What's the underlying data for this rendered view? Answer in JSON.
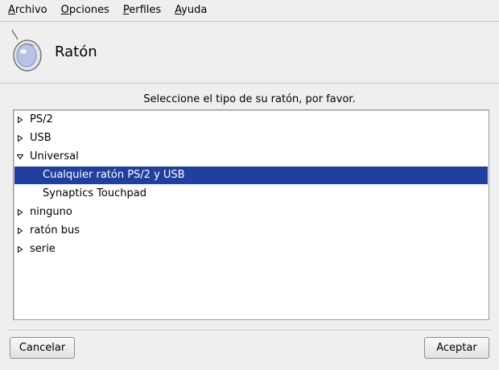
{
  "menubar": {
    "items": [
      {
        "accel": "A",
        "rest": "rchivo"
      },
      {
        "accel": "O",
        "rest": "pciones"
      },
      {
        "accel": "P",
        "rest": "erfiles"
      },
      {
        "accel": "A",
        "rest": "yuda"
      }
    ]
  },
  "header": {
    "title": "Ratón",
    "icon": "mouse-icon"
  },
  "prompt": "Seleccione el tipo de su ratón, por favor.",
  "tree": {
    "items": [
      {
        "label": "PS/2",
        "expanded": false,
        "level": 0
      },
      {
        "label": "USB",
        "expanded": false,
        "level": 0
      },
      {
        "label": "Universal",
        "expanded": true,
        "level": 0
      },
      {
        "label": "Cualquier ratón PS/2 y USB",
        "level": 1,
        "selected": true
      },
      {
        "label": "Synaptics Touchpad",
        "level": 1
      },
      {
        "label": "ninguno",
        "expanded": false,
        "level": 0
      },
      {
        "label": "ratón bus",
        "expanded": false,
        "level": 0
      },
      {
        "label": "serie",
        "expanded": false,
        "level": 0
      }
    ]
  },
  "buttons": {
    "cancel": "Cancelar",
    "accept": "Aceptar"
  },
  "colors": {
    "selection": "#2040a0",
    "background": "#efefef"
  }
}
